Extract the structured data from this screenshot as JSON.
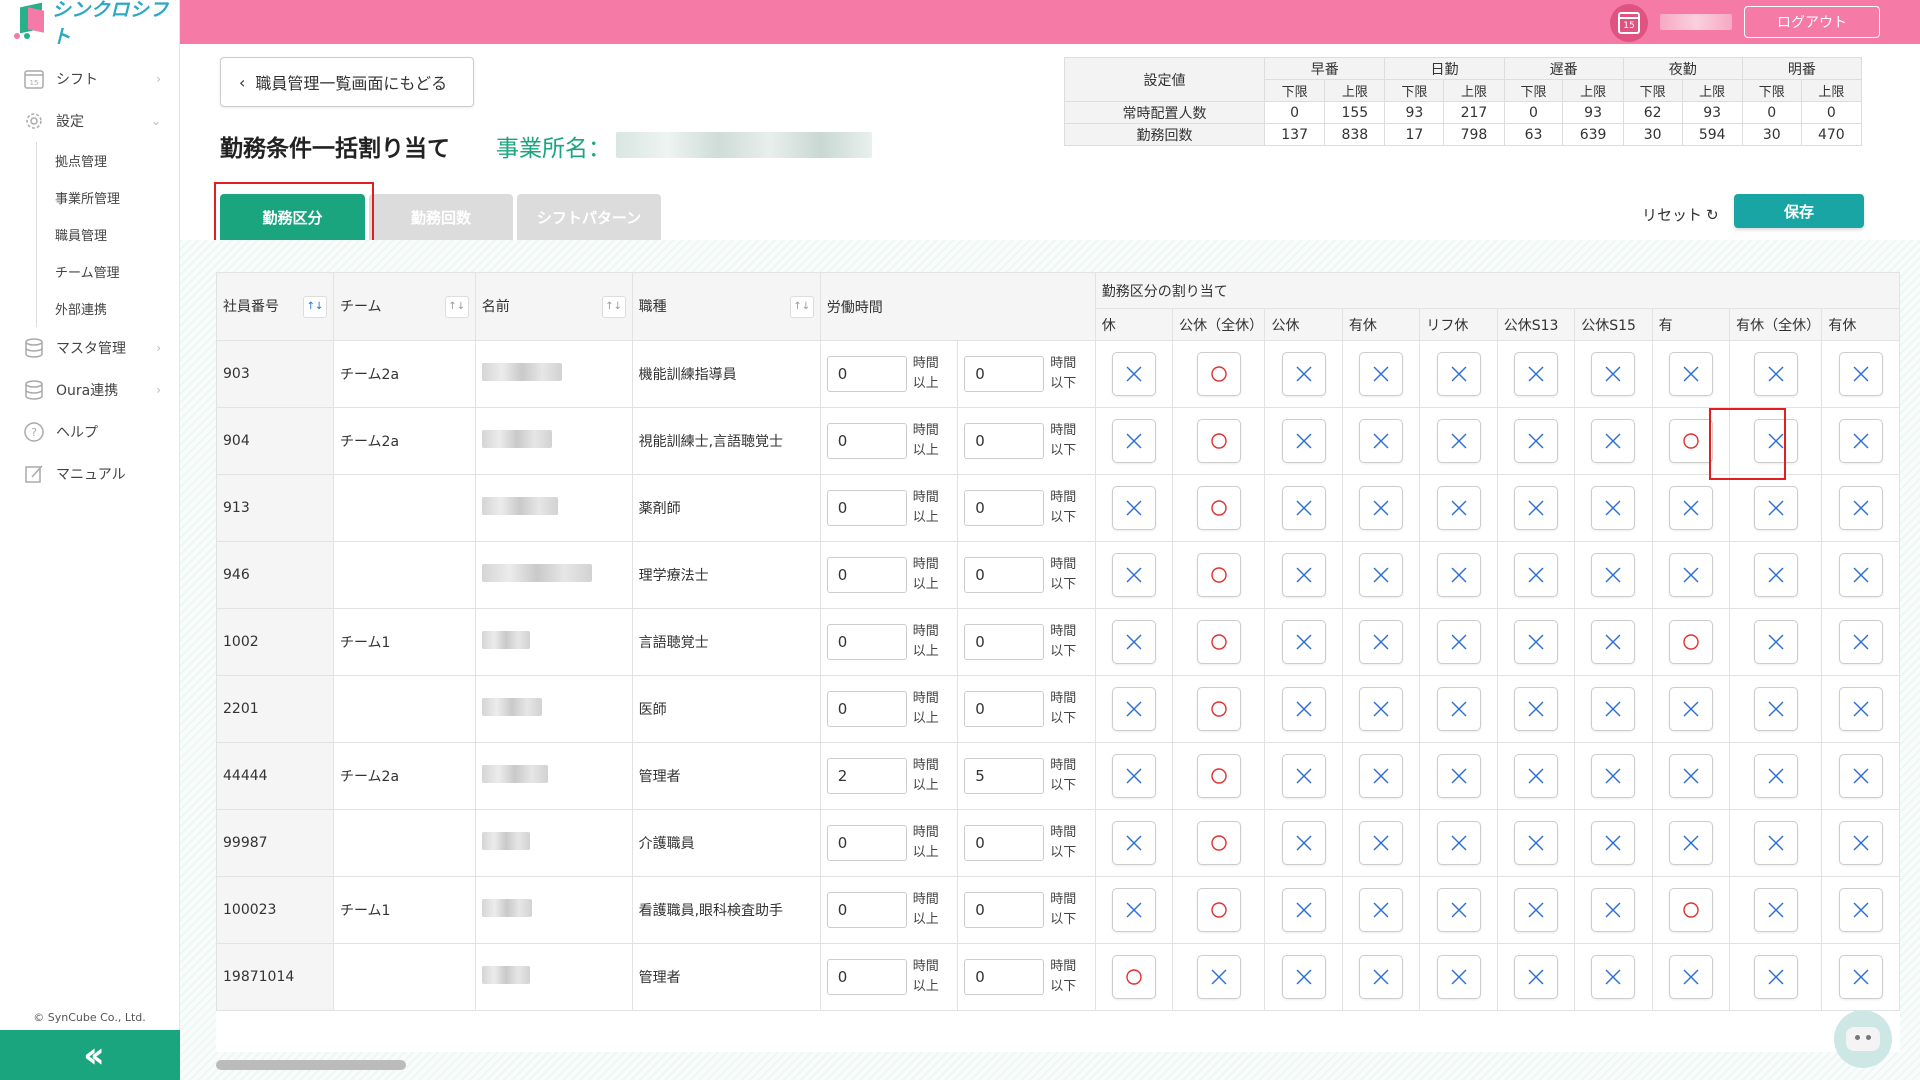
{
  "brand": {
    "name": "シンクロシフト"
  },
  "sidebar": {
    "items": [
      {
        "label": "シフト",
        "icon": "calendar-icon"
      },
      {
        "label": "設定",
        "icon": "gear-icon"
      }
    ],
    "sub_items": [
      "拠点管理",
      "事業所管理",
      "職員管理",
      "チーム管理",
      "外部連携"
    ],
    "items_after": [
      {
        "label": "マスタ管理",
        "icon": "database-icon"
      },
      {
        "label": "Oura連携",
        "icon": "database-icon"
      },
      {
        "label": "ヘルプ",
        "icon": "help-icon"
      },
      {
        "label": "マニュアル",
        "icon": "edit-icon"
      }
    ],
    "copyright": "© SynCube Co., Ltd.",
    "calendar_badge": "15"
  },
  "header": {
    "calendar_badge": "15",
    "logout": "ログアウト"
  },
  "main": {
    "back": "職員管理一覧画面にもどる",
    "title": "勤務条件一括割り当て",
    "office_label": "事業所名："
  },
  "summary": {
    "label_header": "設定値",
    "groups": [
      "早番",
      "日勤",
      "遅番",
      "夜勤",
      "明番"
    ],
    "min": "下限",
    "max": "上限",
    "rows": [
      {
        "label": "常時配置人数",
        "values": [
          "0",
          "155",
          "93",
          "217",
          "0",
          "93",
          "62",
          "93",
          "0",
          "0"
        ]
      },
      {
        "label": "勤務回数",
        "values": [
          "137",
          "838",
          "17",
          "798",
          "63",
          "639",
          "30",
          "594",
          "30",
          "470"
        ]
      }
    ]
  },
  "tabs": [
    "勤務区分",
    "勤務回数",
    "シフトパターン"
  ],
  "reset": "リセット",
  "save": "保存",
  "grid": {
    "columns": {
      "id": "社員番号",
      "team": "チーム",
      "name": "名前",
      "job": "職種",
      "hours": "労働時間",
      "assign": "勤務区分の割り当て"
    },
    "hour_units": {
      "min_top": "時間",
      "min_bottom": "以上",
      "max_top": "時間",
      "max_bottom": "以下"
    },
    "shift_types": [
      "休",
      "公休（全休）",
      "公休",
      "有休",
      "リフ休",
      "公休S13",
      "公休S15",
      "有",
      "有休（全休）",
      "有休"
    ],
    "rows": [
      {
        "id": "903",
        "team": "チーム2a",
        "job": "機能訓練指導員",
        "min": "0",
        "max": "0",
        "assign": [
          "x",
          "o",
          "x",
          "x",
          "x",
          "x",
          "x",
          "x",
          "x",
          "x"
        ]
      },
      {
        "id": "904",
        "team": "チーム2a",
        "job": "視能訓練士,言語聴覚士",
        "min": "0",
        "max": "0",
        "assign": [
          "x",
          "o",
          "x",
          "x",
          "x",
          "x",
          "x",
          "o",
          "x",
          "x"
        ]
      },
      {
        "id": "913",
        "team": "",
        "job": "薬剤師",
        "min": "0",
        "max": "0",
        "assign": [
          "x",
          "o",
          "x",
          "x",
          "x",
          "x",
          "x",
          "x",
          "x",
          "x"
        ]
      },
      {
        "id": "946",
        "team": "",
        "job": "理学療法士",
        "min": "0",
        "max": "0",
        "assign": [
          "x",
          "o",
          "x",
          "x",
          "x",
          "x",
          "x",
          "x",
          "x",
          "x"
        ]
      },
      {
        "id": "1002",
        "team": "チーム1",
        "job": "言語聴覚士",
        "min": "0",
        "max": "0",
        "assign": [
          "x",
          "o",
          "x",
          "x",
          "x",
          "x",
          "x",
          "o",
          "x",
          "x"
        ]
      },
      {
        "id": "2201",
        "team": "",
        "job": "医師",
        "min": "0",
        "max": "0",
        "assign": [
          "x",
          "o",
          "x",
          "x",
          "x",
          "x",
          "x",
          "x",
          "x",
          "x"
        ]
      },
      {
        "id": "44444",
        "team": "チーム2a",
        "job": "管理者",
        "min": "2",
        "max": "5",
        "assign": [
          "x",
          "o",
          "x",
          "x",
          "x",
          "x",
          "x",
          "x",
          "x",
          "x"
        ]
      },
      {
        "id": "99987",
        "team": "",
        "job": "介護職員",
        "min": "0",
        "max": "0",
        "assign": [
          "x",
          "o",
          "x",
          "x",
          "x",
          "x",
          "x",
          "x",
          "x",
          "x"
        ]
      },
      {
        "id": "100023",
        "team": "チーム1",
        "job": "看護職員,眼科検査助手",
        "min": "0",
        "max": "0",
        "assign": [
          "x",
          "o",
          "x",
          "x",
          "x",
          "x",
          "x",
          "o",
          "x",
          "x"
        ]
      },
      {
        "id": "19871014",
        "team": "",
        "job": "管理者",
        "min": "0",
        "max": "0",
        "assign": [
          "o",
          "x",
          "x",
          "x",
          "x",
          "x",
          "x",
          "x",
          "x",
          "x"
        ]
      }
    ]
  },
  "colors": {
    "accent": "#1aa57e",
    "header": "#f57aa6",
    "save": "#1aa5a5",
    "highlight": "#e02020",
    "x_mark": "#2b6fd6",
    "o_mark": "#e03030"
  }
}
